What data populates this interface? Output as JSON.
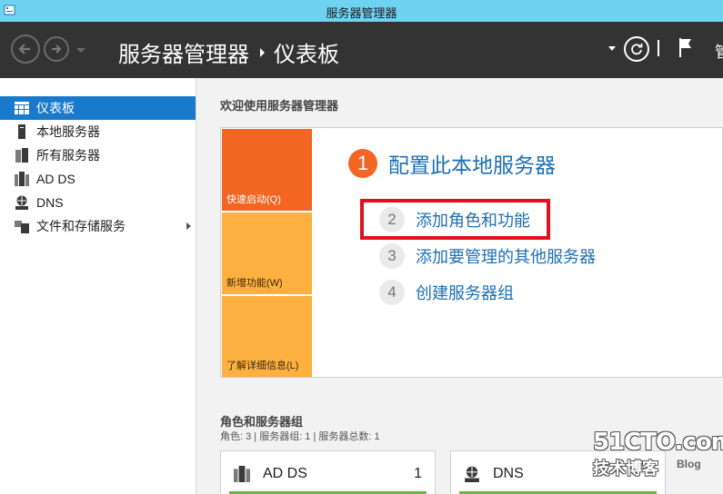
{
  "window": {
    "title": "服务器管理器"
  },
  "header": {
    "breadcrumb_root": "服务器管理器",
    "breadcrumb_current": "仪表板",
    "manage_label": "管"
  },
  "sidebar": {
    "items": [
      {
        "label": "仪表板",
        "icon": "dashboard-icon",
        "active": true
      },
      {
        "label": "本地服务器",
        "icon": "server-icon"
      },
      {
        "label": "所有服务器",
        "icon": "servers-icon"
      },
      {
        "label": "AD DS",
        "icon": "ad-ds-icon"
      },
      {
        "label": "DNS",
        "icon": "dns-icon"
      },
      {
        "label": "文件和存储服务",
        "icon": "file-storage-icon",
        "expandable": true
      }
    ]
  },
  "welcome": {
    "title": "欢迎使用服务器管理器",
    "tiles": [
      "快速启动(Q)",
      "新增功能(W)",
      "了解详细信息(L)"
    ],
    "main_step": {
      "num": "1",
      "label": "配置此本地服务器"
    },
    "steps": [
      {
        "num": "2",
        "label": "添加角色和功能"
      },
      {
        "num": "3",
        "label": "添加要管理的其他服务器"
      },
      {
        "num": "4",
        "label": "创建服务器组"
      }
    ]
  },
  "roles": {
    "title": "角色和服务器组",
    "summary": "角色: 3 | 服务器组: 1 | 服务器总数: 1",
    "cards": [
      {
        "name": "AD DS",
        "count": "1",
        "icon": "ad-ds-icon"
      },
      {
        "name": "DNS",
        "count": "",
        "icon": "dns-icon"
      }
    ]
  },
  "watermark": {
    "site": "51CTO.com",
    "tagline": "技术博客",
    "blog": "Blog"
  },
  "colors": {
    "titlebar": "#6ed3f0",
    "header": "#333333",
    "active_nav": "#1979ca",
    "tile_primary": "#f26522",
    "tile_secondary": "#fbb040",
    "link": "#1d6fb3",
    "highlight": "#e1101b",
    "status_ok": "#6cb33f"
  }
}
